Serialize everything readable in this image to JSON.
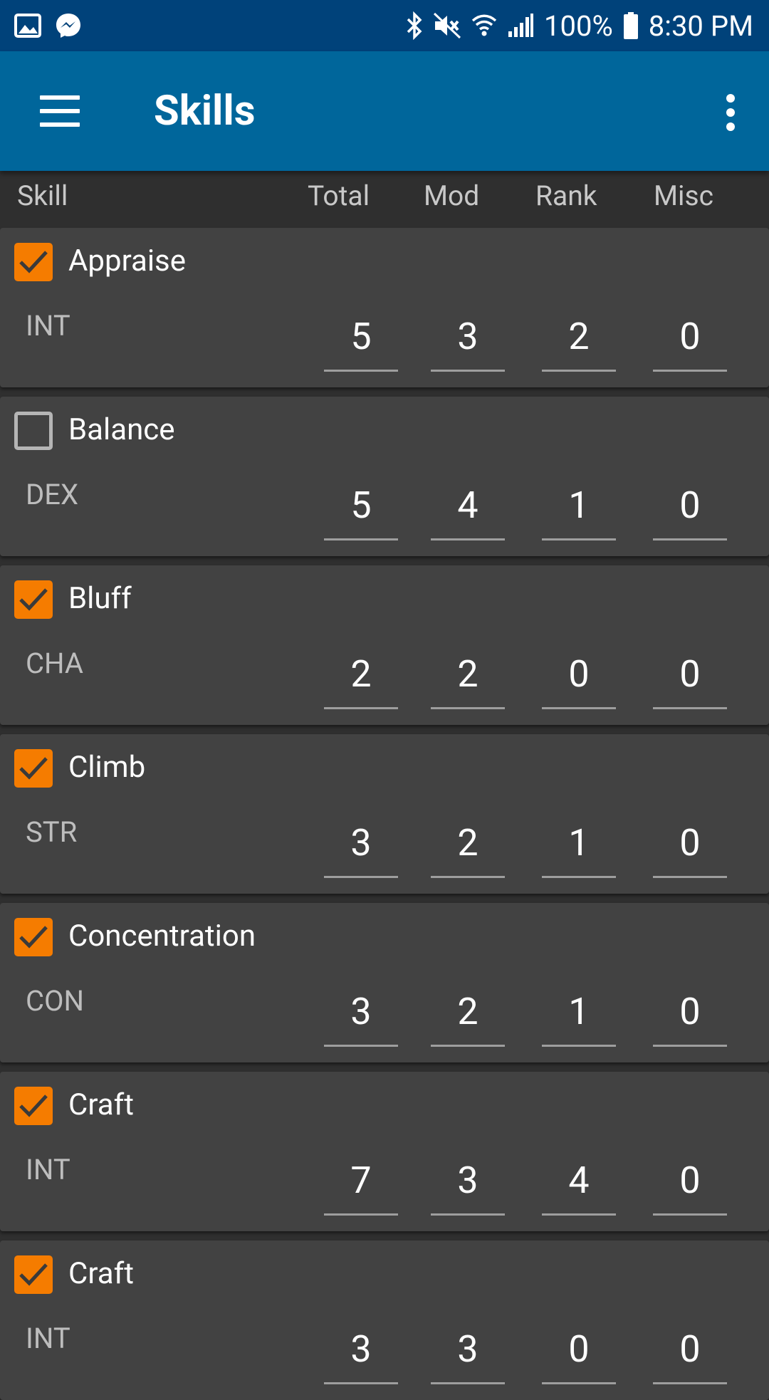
{
  "status_bar": {
    "battery": "100%",
    "time": "8:30 PM",
    "left_icons": [
      "gallery-icon",
      "messenger-icon"
    ],
    "right_icons": [
      "bluetooth-icon",
      "mute-icon",
      "wifi-icon",
      "signal-icon",
      "battery-icon"
    ]
  },
  "app_bar": {
    "title": "Skills",
    "nav_icon": "hamburger-menu-icon",
    "menu_icon": "overflow-menu-icon",
    "background": "#00669b"
  },
  "columns": {
    "skill": "Skill",
    "total": "Total",
    "mod": "Mod",
    "rank": "Rank",
    "misc": "Misc"
  },
  "accent": "#f57c00",
  "skills": [
    {
      "name": "Appraise",
      "checked": true,
      "ability": "INT",
      "total": "5",
      "mod": "3",
      "rank": "2",
      "misc": "0"
    },
    {
      "name": "Balance",
      "checked": false,
      "ability": "DEX",
      "total": "5",
      "mod": "4",
      "rank": "1",
      "misc": "0"
    },
    {
      "name": "Bluff",
      "checked": true,
      "ability": "CHA",
      "total": "2",
      "mod": "2",
      "rank": "0",
      "misc": "0"
    },
    {
      "name": "Climb",
      "checked": true,
      "ability": "STR",
      "total": "3",
      "mod": "2",
      "rank": "1",
      "misc": "0"
    },
    {
      "name": "Concentration",
      "checked": true,
      "ability": "CON",
      "total": "3",
      "mod": "2",
      "rank": "1",
      "misc": "0"
    },
    {
      "name": "Craft",
      "checked": true,
      "ability": "INT",
      "total": "7",
      "mod": "3",
      "rank": "4",
      "misc": "0"
    },
    {
      "name": "Craft",
      "checked": true,
      "ability": "INT",
      "total": "3",
      "mod": "3",
      "rank": "0",
      "misc": "0"
    }
  ]
}
